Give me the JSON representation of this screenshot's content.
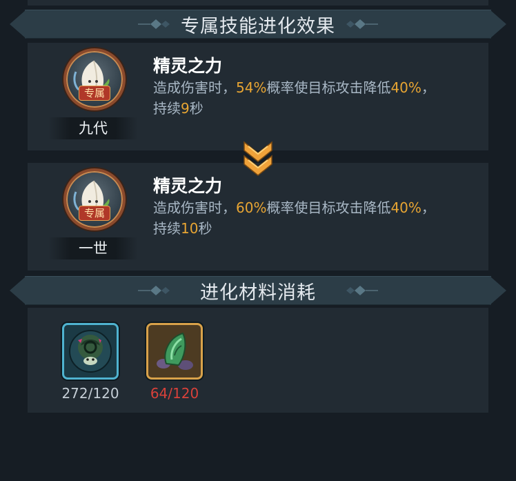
{
  "sections": {
    "skill_title": "专属技能进化效果",
    "material_title": "进化材料消耗"
  },
  "skills": [
    {
      "tag": "专属",
      "generation": "九代",
      "name": "精灵之力",
      "desc_a": "造成伤害时，",
      "chance": "54%",
      "desc_b": "概率使目标攻击降低",
      "reduce": "40%",
      "desc_c": "，",
      "desc_d": "持续",
      "duration": "9",
      "desc_e": "秒"
    },
    {
      "tag": "专属",
      "generation": "一世",
      "name": "精灵之力",
      "desc_a": "造成伤害时，",
      "chance": "60%",
      "desc_b": "概率使目标攻击降低",
      "reduce": "40%",
      "desc_c": "，",
      "desc_d": "持续",
      "duration": "10",
      "desc_e": "秒"
    }
  ],
  "materials": [
    {
      "icon": "character-shard-icon",
      "count": "272/120",
      "status_color": "#c5ced6"
    },
    {
      "icon": "green-crystal-icon",
      "count": "64/120",
      "status_color": "#d8413a"
    }
  ],
  "colors": {
    "highlight": "#e8a533",
    "background": "#161d24",
    "panel": "#222b33",
    "banner": "#2c3d47"
  }
}
